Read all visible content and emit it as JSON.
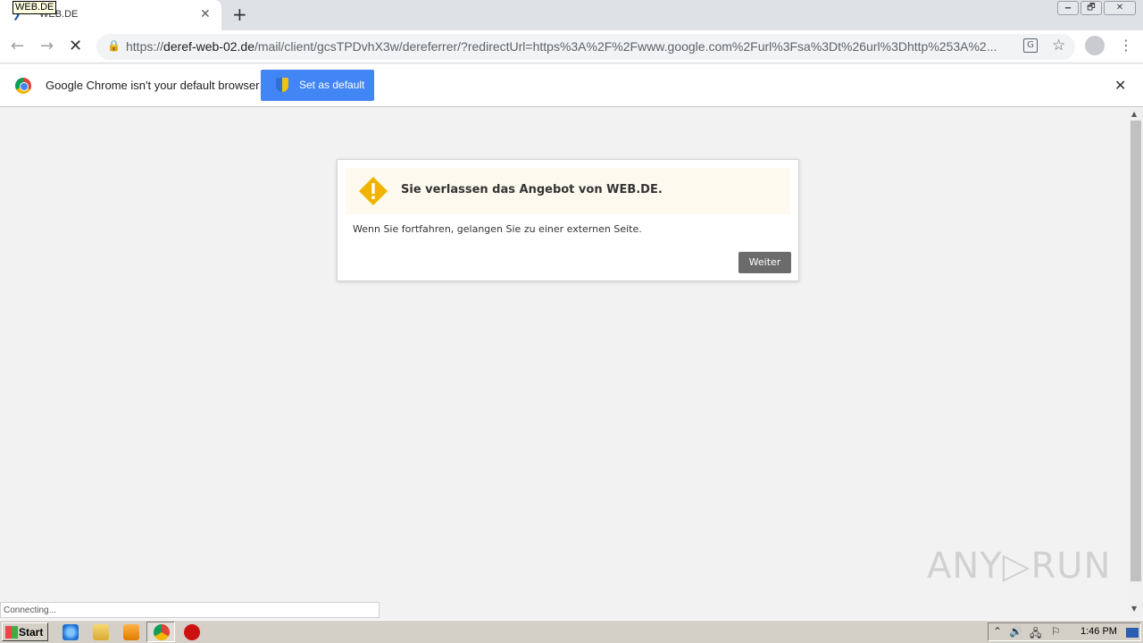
{
  "browser": {
    "tab": {
      "title": "WEB.DE",
      "tooltip": "WEB.DE",
      "close_glyph": "✕"
    },
    "new_tab_glyph": "+",
    "window_controls": [
      "🗕",
      "🗗",
      "✕"
    ],
    "nav": {
      "back_glyph": "←",
      "forward_glyph": "→",
      "stop_glyph": "✕"
    },
    "address": {
      "scheme": "https://",
      "host": "deref-web-02.de",
      "path": "/mail/client/gcsTPDvhX3w/dereferrer/?redirectUrl=https%3A%2F%2Fwww.google.com%2Furl%3Fsa%3Dt%26url%3Dhttp%253A%2..."
    },
    "icons": {
      "lock": "🔒",
      "translate": "G",
      "star": "☆",
      "menu": "⋮"
    }
  },
  "infobar": {
    "message": "Google Chrome isn't your default browser",
    "button_label": "Set as default",
    "close_glyph": "✕"
  },
  "dialog": {
    "title": "Sie verlassen das Angebot von WEB.DE.",
    "body": "Wenn Sie fortfahren, gelangen Sie zu einer externen Seite.",
    "button_label": "Weiter",
    "warning_color": "#f0b400"
  },
  "watermark": "ANY▷RUN",
  "status": "Connecting...",
  "taskbar": {
    "start_label": "Start",
    "clock": "1:46 PM"
  },
  "colors": {
    "accent": "#4285f4",
    "page_bg": "#f2f2f2"
  }
}
